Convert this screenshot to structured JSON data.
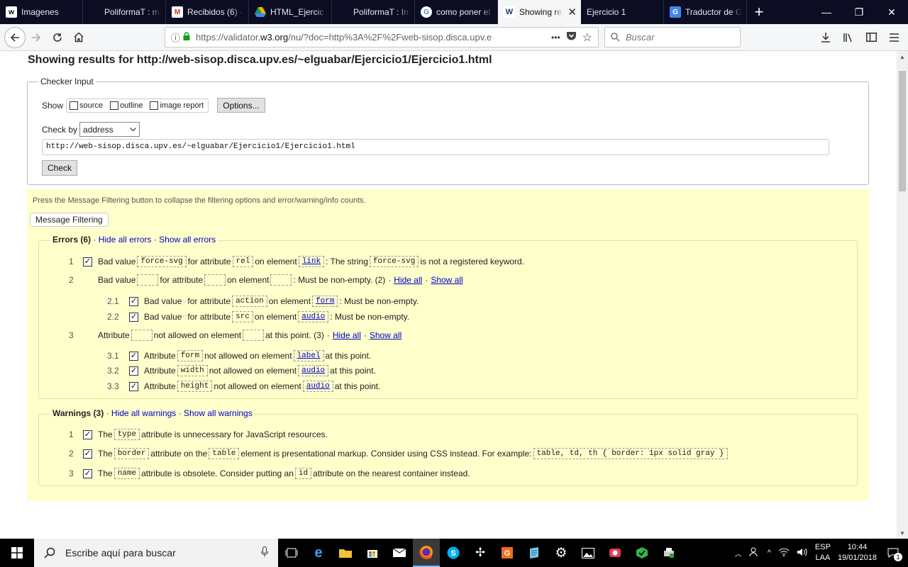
{
  "browser": {
    "tabs": [
      {
        "label": "Imagenes",
        "icon": "w-icon",
        "color": "#ffffff"
      },
      {
        "label": "PoliformaT : mi Po",
        "icon": "blank-icon",
        "color": "#e8e8f0"
      },
      {
        "label": "Recibidos (6) -",
        "icon": "gmail-icon",
        "color": "#d93025"
      },
      {
        "label": "HTML_Ejercic",
        "icon": "drive-icon",
        "color": "#f4b400"
      },
      {
        "label": "PoliformaT : Imm",
        "icon": "blank-icon",
        "color": "#e8e8f0"
      },
      {
        "label": "como poner el",
        "icon": "google-icon",
        "color": "#4285f4"
      },
      {
        "label": "Showing re",
        "icon": "w3c-icon",
        "color": "#1a3a6b",
        "active": true,
        "close": "✕"
      },
      {
        "label": "Ejercicio 1",
        "icon": "blank-icon",
        "color": "#e8e8f0"
      },
      {
        "label": "Traductor de G",
        "icon": "translate-icon",
        "color": "#4285f4"
      }
    ],
    "new_tab": "+",
    "url_prefix": "https://validator.",
    "url_domain": "w3.org",
    "url_rest": "/nu/?doc=http%3A%2F%2Fweb-sisop.disca.upv.e",
    "url_more": "•••",
    "search_placeholder": "Buscar"
  },
  "page": {
    "title": "Showing results for http://web-sisop.disca.upv.es/~elguabar/Ejercicio1/Ejercicio1.html",
    "checker": {
      "legend": "Checker Input",
      "show_label": "Show",
      "options": [
        "source",
        "outline",
        "image report"
      ],
      "options_button": "Options...",
      "check_by_label": "Check by",
      "check_by_value": "address",
      "url_value": "http://web-sisop.disca.upv.es/~elguabar/Ejercicio1/Ejercicio1.html",
      "check_button": "Check"
    },
    "filter": {
      "hint": "Press the Message Filtering button to collapse the filtering options and error/warning/info counts.",
      "button": "Message Filtering",
      "errors": {
        "title": "Errors (6)",
        "hide_all": "Hide all errors",
        "show_all": "Show all errors",
        "sep": "·",
        "e1": {
          "num": "1",
          "t1": "Bad value",
          "c1": "force-svg",
          "t2": "for attribute",
          "c2": "rel",
          "t3": "on element",
          "c3": "link",
          "t4": ": The string",
          "c4": "force-svg",
          "t5": "is not a registered keyword."
        },
        "e2": {
          "num": "2",
          "t1": "Bad value",
          "t2": "for attribute",
          "t3": "on element",
          "t4": ": Must be non-empty. (2)",
          "hide": "Hide all",
          "show": "Show all"
        },
        "e21": {
          "num": "2.1",
          "t1": "Bad value",
          "t2": "for attribute",
          "c2": "action",
          "t3": "on element",
          "c3": "form",
          "t4": ": Must be non-empty."
        },
        "e22": {
          "num": "2.2",
          "t1": "Bad value",
          "t2": "for attribute",
          "c2": "src",
          "t3": "on element",
          "c3": "audio",
          "t4": ": Must be non-empty."
        },
        "e3": {
          "num": "3",
          "t1": "Attribute",
          "t2": "not allowed on element",
          "t3": "at this point. (3)",
          "hide": "Hide all",
          "show": "Show all"
        },
        "e31": {
          "num": "3.1",
          "t1": "Attribute",
          "c1": "form",
          "t2": "not allowed on element",
          "c2": "label",
          "t3": "at this point."
        },
        "e32": {
          "num": "3.2",
          "t1": "Attribute",
          "c1": "width",
          "t2": "not allowed on element",
          "c2": "audio",
          "t3": "at this point."
        },
        "e33": {
          "num": "3.3",
          "t1": "Attribute",
          "c1": "height",
          "t2": "not allowed on element",
          "c2": "audio",
          "t3": "at this point."
        }
      },
      "warnings": {
        "title": "Warnings (3)",
        "hide_all": "Hide all warnings",
        "show_all": "Show all warnings",
        "w1": {
          "num": "1",
          "t1": "The",
          "c1": "type",
          "t2": "attribute is unnecessary for JavaScript resources."
        },
        "w2": {
          "num": "2",
          "t1": "The",
          "c1": "border",
          "t2": "attribute on the",
          "c2": "table",
          "t3": "element is presentational markup. Consider using CSS instead. For example:",
          "c3": "table, td, th { border: 1px solid gray }"
        },
        "w3": {
          "num": "3",
          "t1": "The",
          "c1": "name",
          "t2": "attribute is obsolete. Consider putting an",
          "c2": "id",
          "t3": "attribute on the nearest container instead."
        }
      },
      "check_mark": "✓"
    }
  },
  "taskbar": {
    "search_placeholder": "Escribe aquí para buscar",
    "lang_top": "ESP",
    "lang_bottom": "LAA",
    "time": "10:44",
    "date": "19/01/2018",
    "notifications": "1"
  }
}
